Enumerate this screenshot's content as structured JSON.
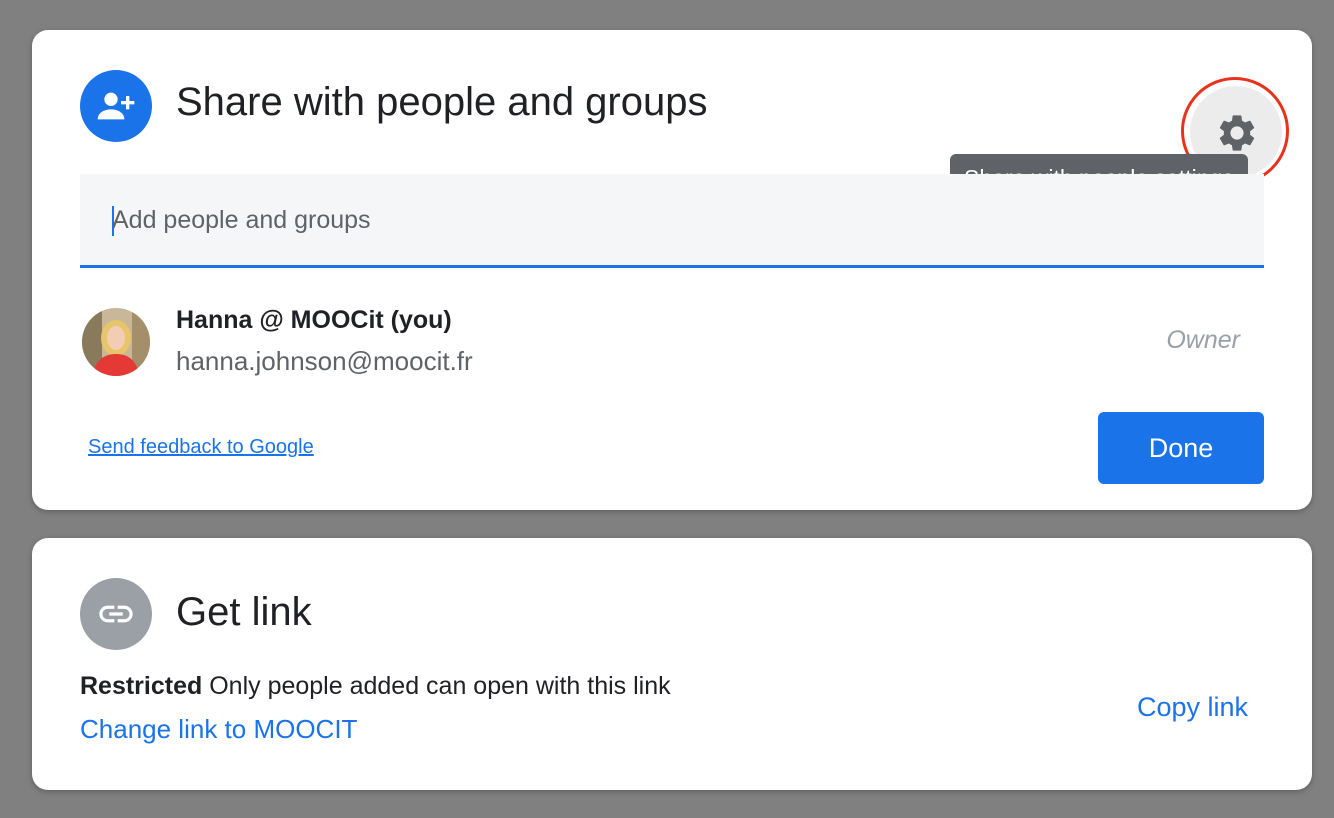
{
  "share_panel": {
    "title": "Share with people and groups",
    "settings_tooltip": "Share with people settings",
    "add_people_placeholder": "Add people and groups",
    "user": {
      "name": "Hanna @ MOOCit (you)",
      "email": "hanna.johnson@moocit.fr",
      "role": "Owner"
    },
    "feedback_link": "Send feedback to Google",
    "done_label": "Done",
    "icons": {
      "header": "add-person-icon",
      "settings": "gear-icon"
    }
  },
  "link_panel": {
    "title": "Get link",
    "status_bold": "Restricted",
    "status_text": "Only people added can open with this link",
    "change_link": "Change link to MOOCIT",
    "copy_link": "Copy link",
    "icons": {
      "header": "link-icon"
    }
  },
  "colors": {
    "accent": "#1a73e8",
    "highlight_ring": "#e8331c",
    "backdrop": "#808080",
    "tooltip_bg": "#5f6368"
  }
}
